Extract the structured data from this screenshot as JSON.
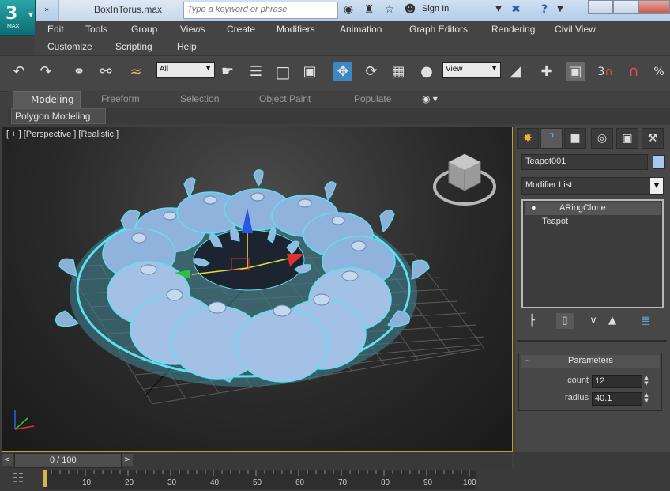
{
  "app": {
    "logo_text": "MAX",
    "document_title": "BoxInTorus.max",
    "search_placeholder": "Type a keyword or phrase",
    "sign_in_label": "Sign In"
  },
  "menu": {
    "row1": [
      "Edit",
      "Tools",
      "Group",
      "Views",
      "Create",
      "Modifiers",
      "Animation",
      "Graph Editors",
      "Rendering",
      "Civil View"
    ],
    "row2": [
      "Customize",
      "Scripting",
      "Help"
    ]
  },
  "toolbar": {
    "selection_filter": "All",
    "ref_coord_system": "View",
    "snap_label": "3",
    "percent_snap_label": "%"
  },
  "ribbon": {
    "tabs": [
      "Modeling",
      "Freeform",
      "Selection",
      "Object Paint",
      "Populate"
    ],
    "active_tab": "Modeling",
    "panel_label": "Polygon Modeling"
  },
  "viewport": {
    "label": "[ + ] [Perspective ] [Realistic ]"
  },
  "command_panel": {
    "object_name": "Teapot001",
    "object_color": "#a8c8f0",
    "modifier_list_label": "Modifier List",
    "stack": [
      "ARingClone",
      "Teapot"
    ],
    "rollout_title": "Parameters",
    "rollout_toggle": "-",
    "params": [
      {
        "label": "count",
        "value": "12"
      },
      {
        "label": "radius",
        "value": "40.1"
      }
    ]
  },
  "timeline": {
    "time_slider_label": "0 / 100",
    "tick_labels": [
      "10",
      "20",
      "30",
      "40",
      "50",
      "60",
      "70",
      "80",
      "90",
      "100"
    ]
  }
}
